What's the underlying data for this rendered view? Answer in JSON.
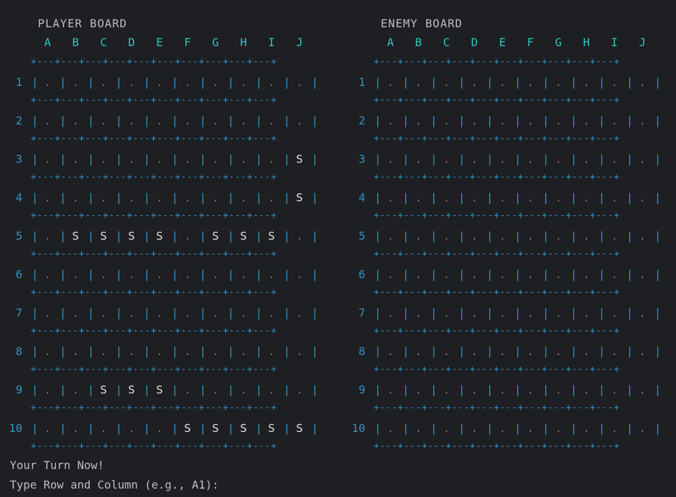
{
  "colors": {
    "background": "#1e1f22",
    "title": "#bcbec4",
    "column_header": "#2fc4c4",
    "grid": "#3592c4",
    "empty_cell": "#6f737a",
    "ship_cell": "#e2e4e8"
  },
  "columns": [
    "A",
    "B",
    "C",
    "D",
    "E",
    "F",
    "G",
    "H",
    "I",
    "J"
  ],
  "rows": [
    "1",
    "2",
    "3",
    "4",
    "5",
    "6",
    "7",
    "8",
    "9",
    "10"
  ],
  "separator": "+---+---+---+---+---+---+---+---+---+---+",
  "player_board": {
    "title": "PLAYER BOARD",
    "grid": [
      [
        ".",
        ".",
        ".",
        ".",
        ".",
        ".",
        ".",
        ".",
        ".",
        "."
      ],
      [
        ".",
        ".",
        ".",
        ".",
        ".",
        ".",
        ".",
        ".",
        ".",
        "."
      ],
      [
        ".",
        ".",
        ".",
        ".",
        ".",
        ".",
        ".",
        ".",
        ".",
        "S"
      ],
      [
        ".",
        ".",
        ".",
        ".",
        ".",
        ".",
        ".",
        ".",
        ".",
        "S"
      ],
      [
        ".",
        "S",
        "S",
        "S",
        "S",
        ".",
        "S",
        "S",
        "S",
        "."
      ],
      [
        ".",
        ".",
        ".",
        ".",
        ".",
        ".",
        ".",
        ".",
        ".",
        "."
      ],
      [
        ".",
        ".",
        ".",
        ".",
        ".",
        ".",
        ".",
        ".",
        ".",
        "."
      ],
      [
        ".",
        ".",
        ".",
        ".",
        ".",
        ".",
        ".",
        ".",
        ".",
        "."
      ],
      [
        ".",
        ".",
        "S",
        "S",
        "S",
        ".",
        ".",
        ".",
        ".",
        "."
      ],
      [
        ".",
        ".",
        ".",
        ".",
        ".",
        "S",
        "S",
        "S",
        "S",
        "S"
      ]
    ]
  },
  "enemy_board": {
    "title": "ENEMY BOARD",
    "grid": [
      [
        ".",
        ".",
        ".",
        ".",
        ".",
        ".",
        ".",
        ".",
        ".",
        "."
      ],
      [
        ".",
        ".",
        ".",
        ".",
        ".",
        ".",
        ".",
        ".",
        ".",
        "."
      ],
      [
        ".",
        ".",
        ".",
        ".",
        ".",
        ".",
        ".",
        ".",
        ".",
        "."
      ],
      [
        ".",
        ".",
        ".",
        ".",
        ".",
        ".",
        ".",
        ".",
        ".",
        "."
      ],
      [
        ".",
        ".",
        ".",
        ".",
        ".",
        ".",
        ".",
        ".",
        ".",
        "."
      ],
      [
        ".",
        ".",
        ".",
        ".",
        ".",
        ".",
        ".",
        ".",
        ".",
        "."
      ],
      [
        ".",
        ".",
        ".",
        ".",
        ".",
        ".",
        ".",
        ".",
        ".",
        "."
      ],
      [
        ".",
        ".",
        ".",
        ".",
        ".",
        ".",
        ".",
        ".",
        ".",
        "."
      ],
      [
        ".",
        ".",
        ".",
        ".",
        ".",
        ".",
        ".",
        ".",
        ".",
        "."
      ],
      [
        ".",
        ".",
        ".",
        ".",
        ".",
        ".",
        ".",
        ".",
        ".",
        "."
      ]
    ]
  },
  "status": {
    "turn_message": "Your Turn Now!",
    "prompt": "Type Row and Column (e.g., A1):"
  }
}
